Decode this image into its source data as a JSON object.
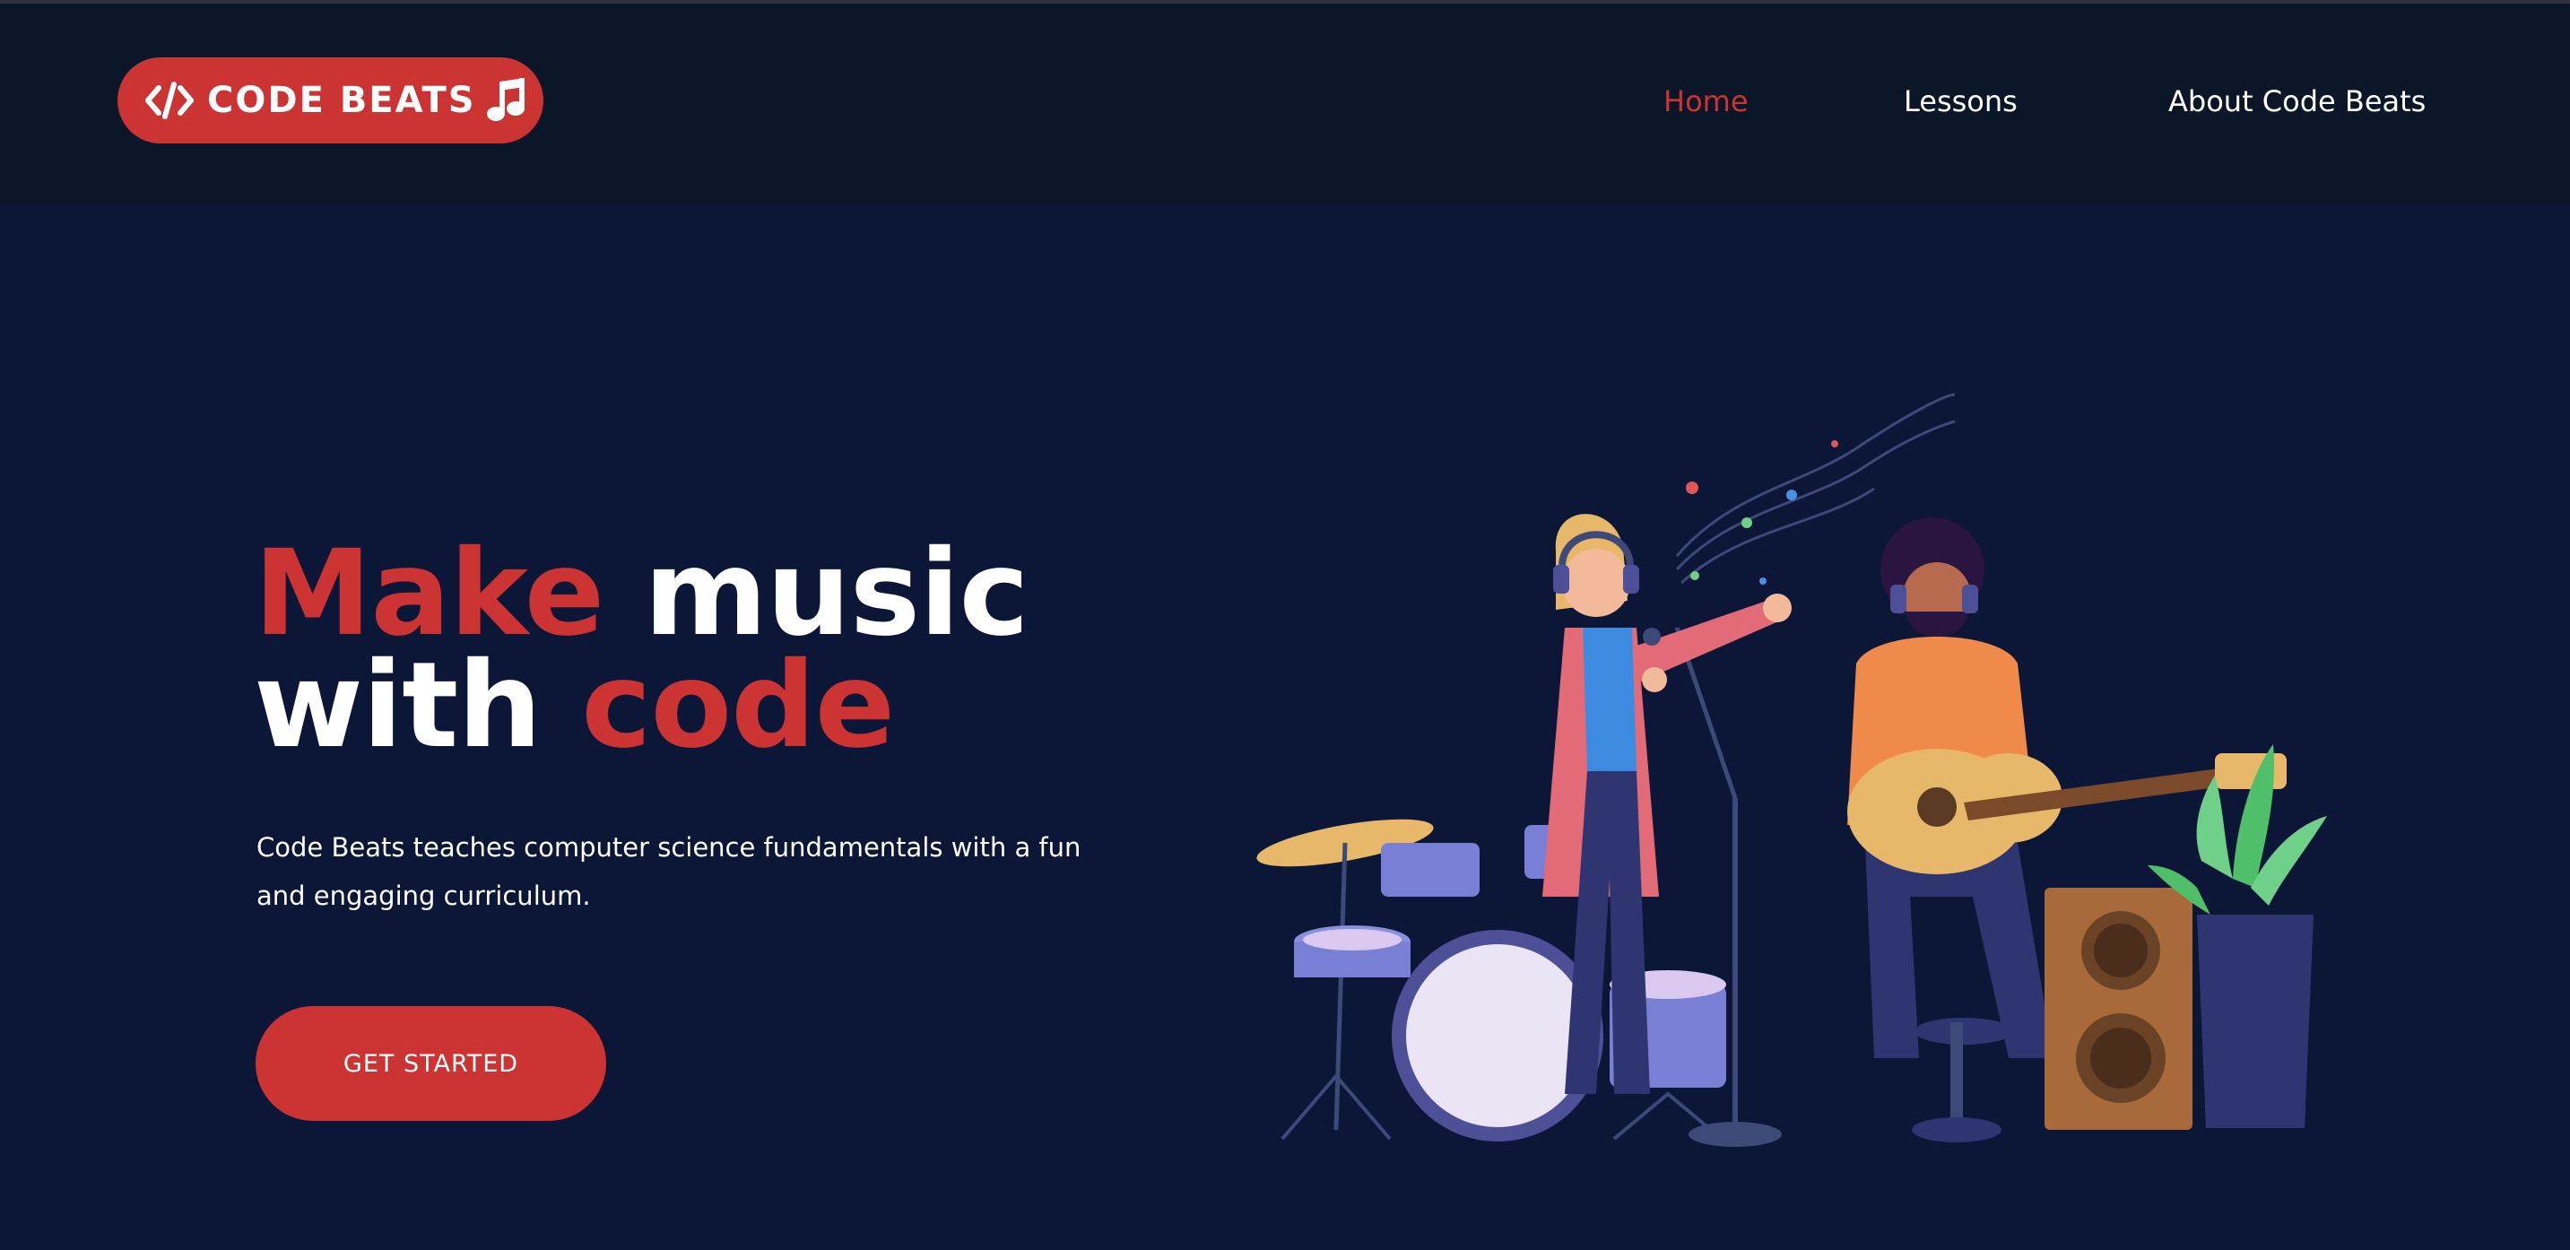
{
  "header": {
    "logo_text": "CODE BEATS",
    "nav": [
      {
        "label": "Home",
        "active": true
      },
      {
        "label": "Lessons",
        "active": false
      },
      {
        "label": "About Code Beats",
        "active": false
      }
    ]
  },
  "hero": {
    "title_word1": "Make",
    "title_word2": "music",
    "title_word3": "with",
    "title_word4": "code",
    "subtitle": "Code Beats teaches computer science fundamentals with a fun and engaging curriculum.",
    "cta_label": "GET STARTED"
  },
  "icons": {
    "logo_left": "code-brackets-icon",
    "logo_right": "music-note-icon",
    "illustration": "musicians-illustration"
  },
  "colors": {
    "background": "#0c1738",
    "navbar": "#0b1628",
    "accent": "#cc3333",
    "text": "#ffffff"
  }
}
